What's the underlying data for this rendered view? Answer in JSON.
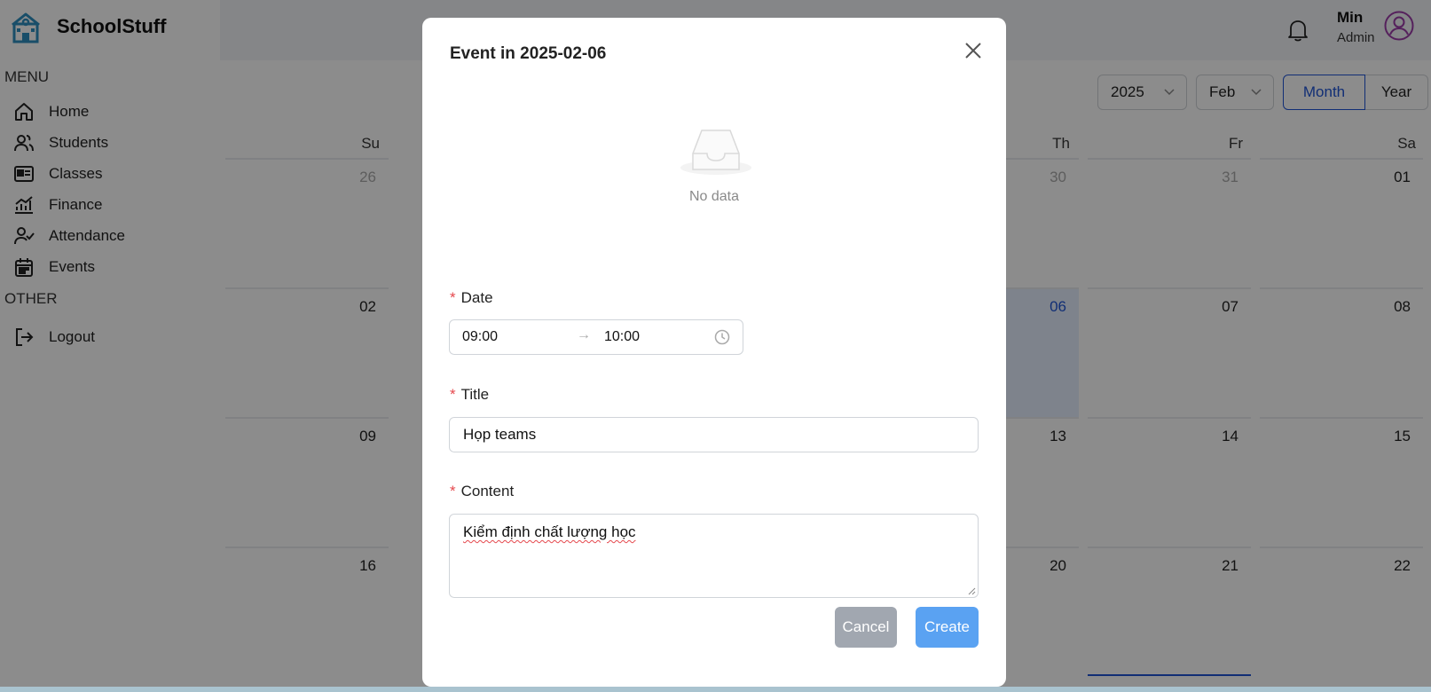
{
  "brand": {
    "name": "SchoolStuff",
    "logo_icon": "school-icon"
  },
  "sidebar": {
    "menu_label": "MENU",
    "other_label": "OTHER",
    "items": [
      {
        "label": "Home",
        "icon": "home-icon"
      },
      {
        "label": "Students",
        "icon": "users-icon"
      },
      {
        "label": "Classes",
        "icon": "id-card-icon"
      },
      {
        "label": "Finance",
        "icon": "chart-icon"
      },
      {
        "label": "Attendance",
        "icon": "user-check-icon"
      },
      {
        "label": "Events",
        "icon": "calendar-icon"
      }
    ],
    "other_items": [
      {
        "label": "Logout",
        "icon": "logout-icon"
      }
    ]
  },
  "header": {
    "user_name": "Min",
    "user_role": "Admin",
    "accent_color": "#9b3ba8"
  },
  "calendar": {
    "year_select": "2025",
    "month_select": "Feb",
    "mode_month": "Month",
    "mode_year": "Year",
    "weekdays": {
      "su": "Su",
      "th": "Th",
      "fr": "Fr",
      "sa": "Sa"
    },
    "rows": [
      {
        "su": "26",
        "th": "30",
        "fr": "31",
        "sa": "01"
      },
      {
        "su": "02",
        "th": "06",
        "fr": "07",
        "sa": "08"
      },
      {
        "su": "09",
        "th": "13",
        "fr": "14",
        "sa": "15"
      },
      {
        "su": "16",
        "th": "20",
        "fr": "21",
        "sa": "22"
      }
    ],
    "today_color": "#1f55d6"
  },
  "modal": {
    "title": "Event in 2025-02-06",
    "empty_text": "No data",
    "date_label": "Date",
    "start_time": "09:00",
    "arrow": "→",
    "end_time": "10:00",
    "title_label": "Title",
    "title_value": "Họp teams",
    "content_label": "Content",
    "content_value": "Kiểm định chất lượng học",
    "cancel_label": "Cancel",
    "create_label": "Create",
    "required_mark": "*"
  }
}
